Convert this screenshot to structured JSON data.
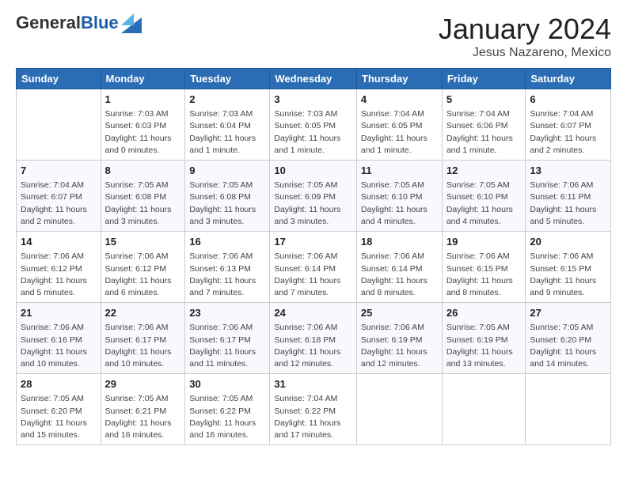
{
  "logo": {
    "general": "General",
    "blue": "Blue"
  },
  "title": "January 2024",
  "location": "Jesus Nazareno, Mexico",
  "headers": [
    "Sunday",
    "Monday",
    "Tuesday",
    "Wednesday",
    "Thursday",
    "Friday",
    "Saturday"
  ],
  "weeks": [
    [
      {
        "day": "",
        "info": ""
      },
      {
        "day": "1",
        "info": "Sunrise: 7:03 AM\nSunset: 6:03 PM\nDaylight: 11 hours\nand 0 minutes."
      },
      {
        "day": "2",
        "info": "Sunrise: 7:03 AM\nSunset: 6:04 PM\nDaylight: 11 hours\nand 1 minute."
      },
      {
        "day": "3",
        "info": "Sunrise: 7:03 AM\nSunset: 6:05 PM\nDaylight: 11 hours\nand 1 minute."
      },
      {
        "day": "4",
        "info": "Sunrise: 7:04 AM\nSunset: 6:05 PM\nDaylight: 11 hours\nand 1 minute."
      },
      {
        "day": "5",
        "info": "Sunrise: 7:04 AM\nSunset: 6:06 PM\nDaylight: 11 hours\nand 1 minute."
      },
      {
        "day": "6",
        "info": "Sunrise: 7:04 AM\nSunset: 6:07 PM\nDaylight: 11 hours\nand 2 minutes."
      }
    ],
    [
      {
        "day": "7",
        "info": "Sunrise: 7:04 AM\nSunset: 6:07 PM\nDaylight: 11 hours\nand 2 minutes."
      },
      {
        "day": "8",
        "info": "Sunrise: 7:05 AM\nSunset: 6:08 PM\nDaylight: 11 hours\nand 3 minutes."
      },
      {
        "day": "9",
        "info": "Sunrise: 7:05 AM\nSunset: 6:08 PM\nDaylight: 11 hours\nand 3 minutes."
      },
      {
        "day": "10",
        "info": "Sunrise: 7:05 AM\nSunset: 6:09 PM\nDaylight: 11 hours\nand 3 minutes."
      },
      {
        "day": "11",
        "info": "Sunrise: 7:05 AM\nSunset: 6:10 PM\nDaylight: 11 hours\nand 4 minutes."
      },
      {
        "day": "12",
        "info": "Sunrise: 7:05 AM\nSunset: 6:10 PM\nDaylight: 11 hours\nand 4 minutes."
      },
      {
        "day": "13",
        "info": "Sunrise: 7:06 AM\nSunset: 6:11 PM\nDaylight: 11 hours\nand 5 minutes."
      }
    ],
    [
      {
        "day": "14",
        "info": "Sunrise: 7:06 AM\nSunset: 6:12 PM\nDaylight: 11 hours\nand 5 minutes."
      },
      {
        "day": "15",
        "info": "Sunrise: 7:06 AM\nSunset: 6:12 PM\nDaylight: 11 hours\nand 6 minutes."
      },
      {
        "day": "16",
        "info": "Sunrise: 7:06 AM\nSunset: 6:13 PM\nDaylight: 11 hours\nand 7 minutes."
      },
      {
        "day": "17",
        "info": "Sunrise: 7:06 AM\nSunset: 6:14 PM\nDaylight: 11 hours\nand 7 minutes."
      },
      {
        "day": "18",
        "info": "Sunrise: 7:06 AM\nSunset: 6:14 PM\nDaylight: 11 hours\nand 8 minutes."
      },
      {
        "day": "19",
        "info": "Sunrise: 7:06 AM\nSunset: 6:15 PM\nDaylight: 11 hours\nand 8 minutes."
      },
      {
        "day": "20",
        "info": "Sunrise: 7:06 AM\nSunset: 6:15 PM\nDaylight: 11 hours\nand 9 minutes."
      }
    ],
    [
      {
        "day": "21",
        "info": "Sunrise: 7:06 AM\nSunset: 6:16 PM\nDaylight: 11 hours\nand 10 minutes."
      },
      {
        "day": "22",
        "info": "Sunrise: 7:06 AM\nSunset: 6:17 PM\nDaylight: 11 hours\nand 10 minutes."
      },
      {
        "day": "23",
        "info": "Sunrise: 7:06 AM\nSunset: 6:17 PM\nDaylight: 11 hours\nand 11 minutes."
      },
      {
        "day": "24",
        "info": "Sunrise: 7:06 AM\nSunset: 6:18 PM\nDaylight: 11 hours\nand 12 minutes."
      },
      {
        "day": "25",
        "info": "Sunrise: 7:06 AM\nSunset: 6:19 PM\nDaylight: 11 hours\nand 12 minutes."
      },
      {
        "day": "26",
        "info": "Sunrise: 7:05 AM\nSunset: 6:19 PM\nDaylight: 11 hours\nand 13 minutes."
      },
      {
        "day": "27",
        "info": "Sunrise: 7:05 AM\nSunset: 6:20 PM\nDaylight: 11 hours\nand 14 minutes."
      }
    ],
    [
      {
        "day": "28",
        "info": "Sunrise: 7:05 AM\nSunset: 6:20 PM\nDaylight: 11 hours\nand 15 minutes."
      },
      {
        "day": "29",
        "info": "Sunrise: 7:05 AM\nSunset: 6:21 PM\nDaylight: 11 hours\nand 16 minutes."
      },
      {
        "day": "30",
        "info": "Sunrise: 7:05 AM\nSunset: 6:22 PM\nDaylight: 11 hours\nand 16 minutes."
      },
      {
        "day": "31",
        "info": "Sunrise: 7:04 AM\nSunset: 6:22 PM\nDaylight: 11 hours\nand 17 minutes."
      },
      {
        "day": "",
        "info": ""
      },
      {
        "day": "",
        "info": ""
      },
      {
        "day": "",
        "info": ""
      }
    ]
  ]
}
